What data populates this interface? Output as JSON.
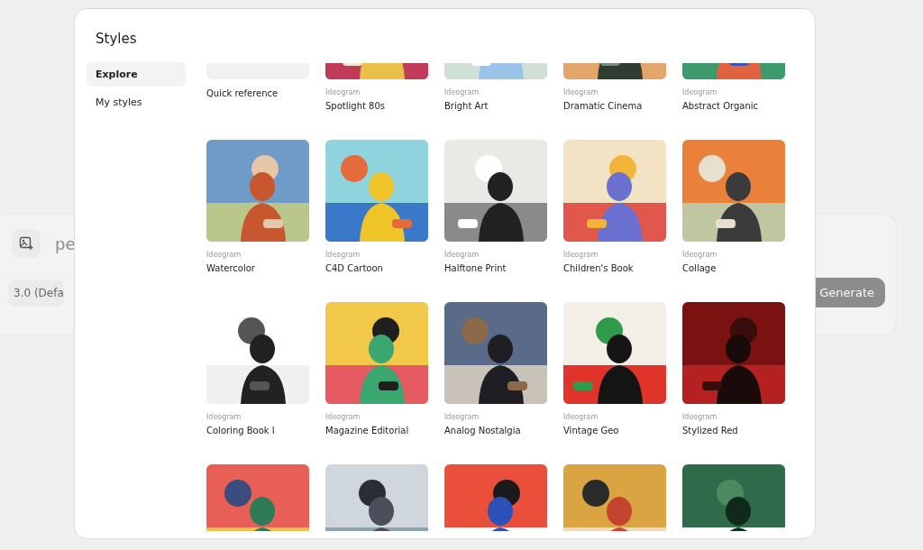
{
  "background": {
    "prompt_text": "pe",
    "model_chip": "3.0 (Defa",
    "generate_button": "Generate"
  },
  "modal": {
    "title": "Styles",
    "sidebar": [
      {
        "label": "Explore",
        "selected": true
      },
      {
        "label": "My styles",
        "selected": false
      }
    ],
    "styles": [
      {
        "kind": "placeholder",
        "name": "Quick reference"
      },
      {
        "kind": "picture",
        "source": "Ideogram",
        "name": "Spotlight 80s"
      },
      {
        "kind": "picture",
        "source": "Ideogram",
        "name": "Bright Art"
      },
      {
        "kind": "picture",
        "source": "Ideogram",
        "name": "Dramatic Cinema"
      },
      {
        "kind": "picture",
        "source": "Ideogram",
        "name": "Abstract Organic"
      },
      {
        "kind": "picture",
        "source": "Ideogram",
        "name": "Watercolor"
      },
      {
        "kind": "picture",
        "source": "Ideogram",
        "name": "C4D Cartoon"
      },
      {
        "kind": "picture",
        "source": "Ideogram",
        "name": "Halftone Print"
      },
      {
        "kind": "picture",
        "source": "Ideogram",
        "name": "Children's Book"
      },
      {
        "kind": "picture",
        "source": "Ideogram",
        "name": "Collage"
      },
      {
        "kind": "picture",
        "source": "Ideogram",
        "name": "Coloring Book I"
      },
      {
        "kind": "picture",
        "source": "Ideogram",
        "name": "Magazine Editorial"
      },
      {
        "kind": "picture",
        "source": "Ideogram",
        "name": "Analog Nostalgia"
      },
      {
        "kind": "picture",
        "source": "Ideogram",
        "name": "Vintage Geo"
      },
      {
        "kind": "picture",
        "source": "Ideogram",
        "name": "Stylized Red"
      },
      {
        "kind": "picture"
      },
      {
        "kind": "picture"
      },
      {
        "kind": "picture"
      },
      {
        "kind": "picture"
      },
      {
        "kind": "picture"
      }
    ]
  }
}
